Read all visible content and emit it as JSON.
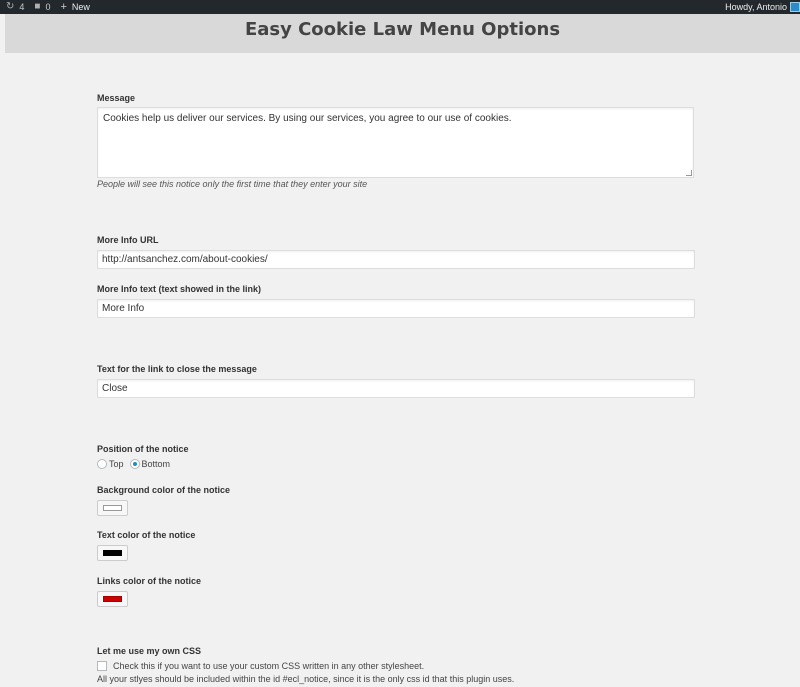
{
  "admin_bar": {
    "updates_count": "4",
    "comments_count": "0",
    "new_label": "New",
    "howdy": "Howdy, Antonio"
  },
  "page": {
    "title": "Easy Cookie Law Menu Options"
  },
  "message": {
    "label": "Message",
    "value": "Cookies help us deliver our services. By using our services, you agree to our use of cookies.",
    "description": "People will see this notice only the first time that they enter your site"
  },
  "more_info_url": {
    "label": "More Info URL",
    "value": "http://antsanchez.com/about-cookies/"
  },
  "more_info_text": {
    "label": "More Info text (text showed in the link)",
    "value": "More Info"
  },
  "close_link": {
    "label": "Text for the link to close the message",
    "value": "Close"
  },
  "position": {
    "label": "Position of the notice",
    "options": [
      "Top",
      "Bottom"
    ],
    "selected": "Bottom"
  },
  "background_color": {
    "label": "Background color of the notice",
    "color": "#ffffff"
  },
  "text_color": {
    "label": "Text color of the notice",
    "color": "#000000"
  },
  "links_color": {
    "label": "Links color of the notice",
    "color": "#cc0000"
  },
  "custom_css": {
    "label": "Let me use my own CSS",
    "checked": false,
    "checkbox_text": "Check this if you want to use your custom CSS written in any other stylesheet.",
    "note": "All your stlyes should be included within the id #ecl_notice, since it is the only css id that this plugin uses."
  }
}
